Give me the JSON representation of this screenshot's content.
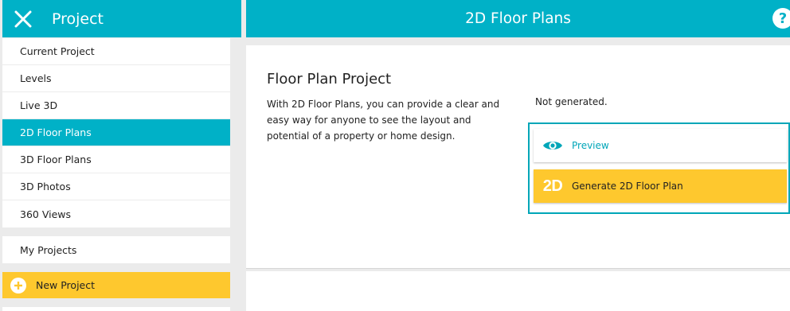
{
  "sidebar": {
    "title": "Project",
    "items": [
      {
        "label": "Current Project"
      },
      {
        "label": "Levels"
      },
      {
        "label": "Live 3D"
      },
      {
        "label": "2D Floor Plans"
      },
      {
        "label": "3D Floor Plans"
      },
      {
        "label": "3D Photos"
      },
      {
        "label": "360 Views"
      }
    ],
    "my_projects_label": "My Projects",
    "new_project_label": "New Project",
    "active_item": "2D Floor Plans"
  },
  "header": {
    "title": "2D Floor Plans",
    "help_label": "?"
  },
  "main": {
    "section_title": "Floor Plan Project",
    "description": "With 2D Floor Plans, you can provide a clear and easy way for anyone to see the layout and potential of a property or home design.",
    "status": "Not generated.",
    "preview_label": "Preview",
    "generate_label": "Generate 2D Floor Plan",
    "generate_icon_text": "2D"
  },
  "colors": {
    "accent": "#00b1c7",
    "highlight": "#fec82e",
    "background": "#ebebeb"
  },
  "icons": [
    "close-icon",
    "help-icon",
    "plus-circle-icon",
    "eye-icon",
    "2d-icon"
  ]
}
